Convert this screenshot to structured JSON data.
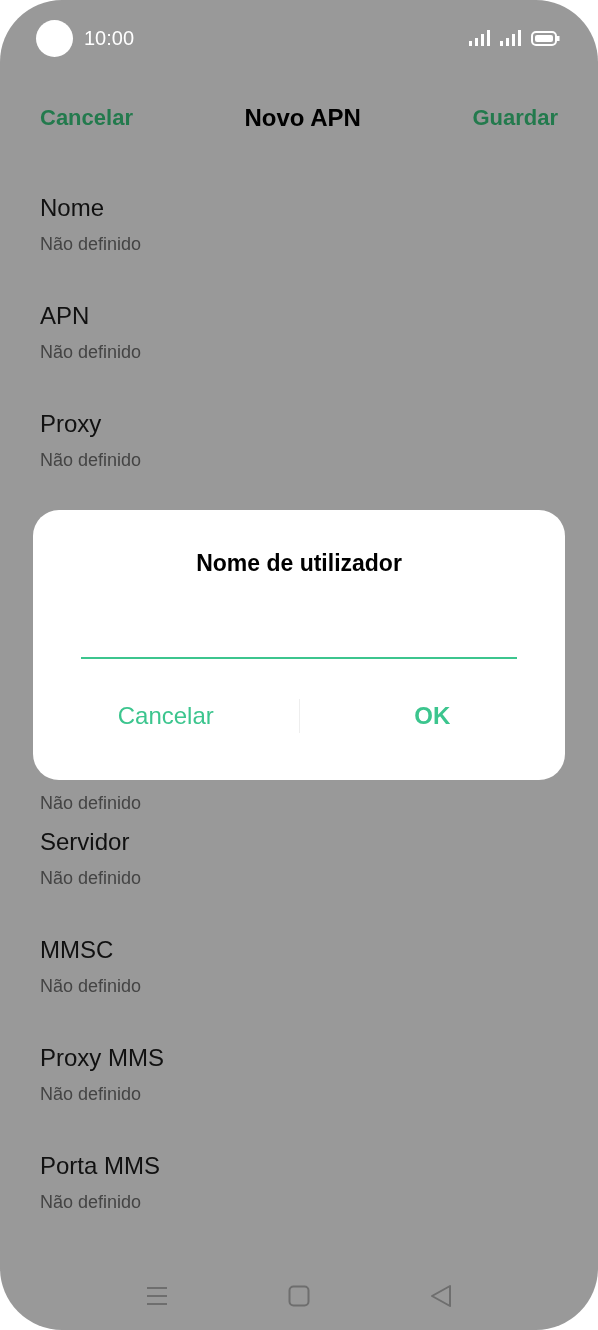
{
  "status_bar": {
    "time": "10:00"
  },
  "header": {
    "cancel": "Cancelar",
    "title": "Novo APN",
    "save": "Guardar"
  },
  "fields_above": [
    {
      "title": "Nome",
      "value": "Não definido"
    },
    {
      "title": "APN",
      "value": "Não definido"
    },
    {
      "title": "Proxy",
      "value": "Não definido"
    }
  ],
  "fields_below": [
    {
      "value": "Não definido"
    },
    {
      "title": "Servidor",
      "value": "Não definido"
    },
    {
      "title": "MMSC",
      "value": "Não definido"
    },
    {
      "title": "Proxy MMS",
      "value": "Não definido"
    },
    {
      "title": "Porta MMS",
      "value": "Não definido"
    }
  ],
  "dialog": {
    "title": "Nome de utilizador",
    "buttons": [
      "Cancelar",
      "OK"
    ]
  }
}
